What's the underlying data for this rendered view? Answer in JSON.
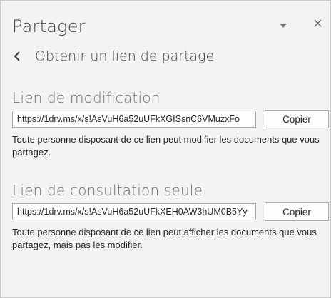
{
  "pane": {
    "title": "Partager",
    "dropdown_icon": "chevron-down-icon",
    "close_icon": "close-icon"
  },
  "back": {
    "label": "Obtenir un lien de partage",
    "icon": "chevron-left-icon"
  },
  "edit_link": {
    "heading": "Lien de modification",
    "url": "https://1drv.ms/x/s!AsVuH6a52uUFkXGISsnC6VMuzxFo",
    "copy_label": "Copier",
    "description": "Toute personne disposant de ce lien peut modifier les documents que vous partagez."
  },
  "view_link": {
    "heading": "Lien de consultation seule",
    "url": "https://1drv.ms/x/s!AsVuH6a52uUFkXEH0AW3hUM0B5Yy",
    "copy_label": "Copier",
    "description": "Toute personne disposant de ce lien peut afficher les documents que vous partagez, mais pas les modifier."
  },
  "colors": {
    "pane_background": "#f3f3f3",
    "text": "#262626",
    "heading": "#6f6f6f",
    "field_border": "#ababab"
  }
}
